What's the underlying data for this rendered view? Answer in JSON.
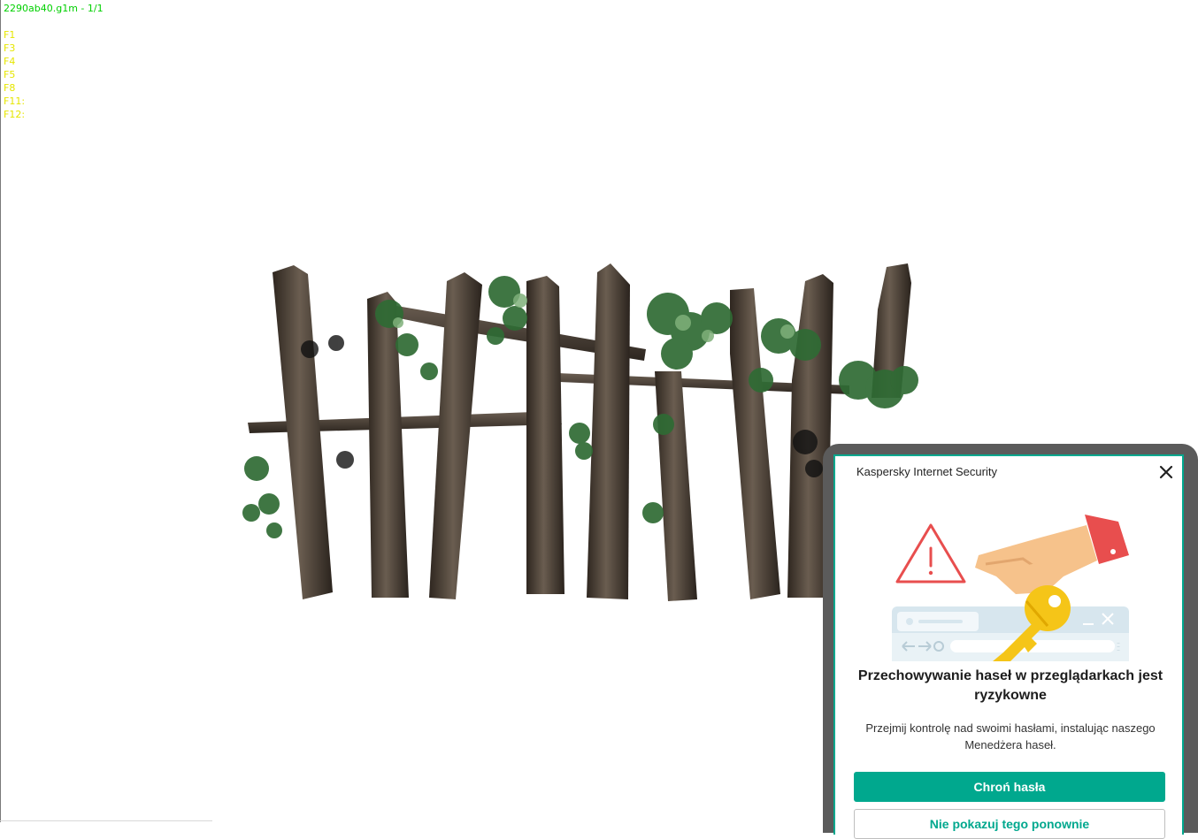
{
  "hud": {
    "title": "2290ab40.g1m - 1/1",
    "keys": [
      "F1",
      "F3",
      "F4",
      "F5",
      "F8",
      "F11:",
      "F12:"
    ]
  },
  "popup": {
    "app_name": "Kaspersky Internet Security",
    "heading": "Przechowywanie haseł w przeglądarkach jest ryzykowne",
    "description": "Przejmij kontrolę nad swoimi hasłami, instalując naszego Menedżera haseł.",
    "primary_label": "Chroń hasła",
    "secondary_label": "Nie pokazuj tego ponownie",
    "accent_color": "#00a88e",
    "warning_color": "#e84e4e",
    "key_color": "#f5c518"
  },
  "icons": {
    "close": "close-icon",
    "warning": "warning-triangle-icon",
    "key": "key-icon",
    "browser": "browser-window-icon"
  }
}
